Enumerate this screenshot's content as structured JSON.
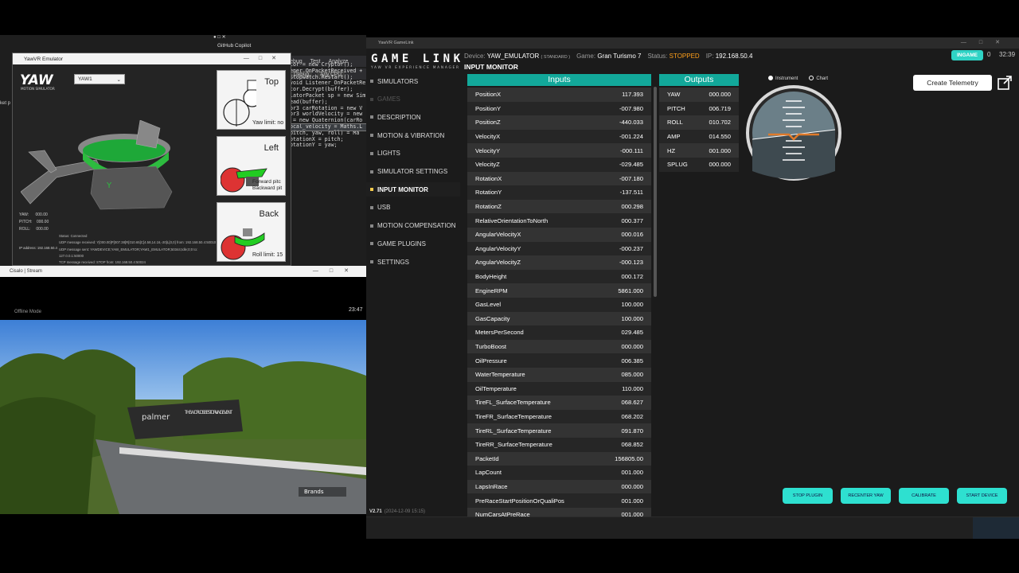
{
  "behind": {
    "github_copilot": "GitHub Copilot",
    "menu": [
      "Debug",
      "Test",
      "Analyze"
    ],
    "config": "Debug",
    "platform": "Any CPU",
    "code": [
      "ptor = new Cryptor();",
      "tener.OnPacketReceived +",
      "pStopwatch.Restart();",
      "",
      "",
      " void Listener_OnPacketRe",
      "",
      "ptor.Decrypt(buffer);",
      "ulatorPacket sp = new Sim",
      "Read(buffer);",
      "",
      "",
      "tor3 carRotation = new V",
      "tor3 worldVelocity = new",
      "",
      "",
      "Q = new Quaternion(carRo",
      "local_velocity = Maths.L",
      "",
      "(pitch, yaw, roll) = Ma",
      "",
      "",
      "RotationX = pitch;",
      "RotationY = yaw;"
    ],
    "left_text": "ket p"
  },
  "emulator": {
    "title": "YawVR Emulator",
    "device_select": "YAW1",
    "logo_sub": "MOTION SIMULATOR",
    "views": [
      {
        "label": "Top",
        "sub": "Yaw limit: no"
      },
      {
        "label": "Left",
        "sub": "Forward pitc\nBackward pit"
      },
      {
        "label": "Back",
        "sub": "Roll limit: 15"
      }
    ],
    "stats": [
      "YAW:      000.00",
      "PITCH:    000.00",
      "ROLL:     000.00"
    ],
    "ip_label": "IP address:  192.168.50.4",
    "log": [
      "Status:  Connected",
      "UDP message received: Y[000.00]P[007.38]R[010.65]C[4.58,14.16,-20]L[0,0] from: 192.168.50.4:50010",
      "UDP message sent: YAWDEVICE;YAW_EMULATOR;YAW1_EMULATOR;50344;Idle;0;0 to: 127.0.0.1:50000",
      "TCP message received: STOP from: 192.168.50.4:50024",
      "TCP message sent: ERROR;INVALID_COMMAND to: 192.168.50.4:50024"
    ]
  },
  "stream": {
    "title": "Cisalo | Stream",
    "offline": "Offline Mode",
    "clock": "23:47",
    "billboard_brand": "palmer",
    "billboard_text": "THE WORLD'S BEST DRIVING EVENT",
    "track_label": "Brands"
  },
  "gamelink": {
    "window_title": "YawVR GameLink",
    "logo": "GAME LINK",
    "logo_sub": "YAW VR EXPERIENCE MANAGER",
    "device_label": "Device:",
    "device": "YAW_EMULATOR",
    "device_type": "( STANDARD )",
    "game_label": "Game:",
    "game": "Gran Turismo 7",
    "status_label": "Status:",
    "status": "STOPPED",
    "ip_label": "IP:",
    "ip": "192.168.50.4",
    "badge": "INGAME",
    "badge_count": "0",
    "time": "32:39",
    "page_title": "INPUT MONITOR",
    "nav": [
      {
        "label": "SIMULATORS",
        "state": "normal"
      },
      {
        "label": "GAMES",
        "state": "dim"
      },
      {
        "label": "DESCRIPTION",
        "state": "normal"
      },
      {
        "label": "MOTION & VIBRATION",
        "state": "normal"
      },
      {
        "label": "LIGHTS",
        "state": "normal"
      },
      {
        "label": "SIMULATOR SETTINGS",
        "state": "normal"
      },
      {
        "label": "INPUT MONITOR",
        "state": "active"
      },
      {
        "label": "USB",
        "state": "normal"
      },
      {
        "label": "MOTION COMPENSATION",
        "state": "normal"
      },
      {
        "label": "GAME PLUGINS",
        "state": "normal"
      },
      {
        "label": "SETTINGS",
        "state": "normal"
      }
    ],
    "version": "V2.71",
    "version_date": "(2024-12-09 15:15)",
    "inputs_header": "Inputs",
    "outputs_header": "Outputs",
    "inputs": [
      [
        "PositionX",
        "117.393"
      ],
      [
        "PositionY",
        "-007.980"
      ],
      [
        "PositionZ",
        "-440.033"
      ],
      [
        "VelocityX",
        "-001.224"
      ],
      [
        "VelocityY",
        "-000.111"
      ],
      [
        "VelocityZ",
        "-029.485"
      ],
      [
        "RotationX",
        "-007.180"
      ],
      [
        "RotationY",
        "-137.511"
      ],
      [
        "RotationZ",
        "000.298"
      ],
      [
        "RelativeOrientationToNorth",
        "000.377"
      ],
      [
        "AngularVelocityX",
        "000.016"
      ],
      [
        "AngularVelocityY",
        "-000.237"
      ],
      [
        "AngularVelocityZ",
        "-000.123"
      ],
      [
        "BodyHeight",
        "000.172"
      ],
      [
        "EngineRPM",
        "5861.000"
      ],
      [
        "GasLevel",
        "100.000"
      ],
      [
        "GasCapacity",
        "100.000"
      ],
      [
        "MetersPerSecond",
        "029.485"
      ],
      [
        "TurboBoost",
        "000.000"
      ],
      [
        "OilPressure",
        "006.385"
      ],
      [
        "WaterTemperature",
        "085.000"
      ],
      [
        "OilTemperature",
        "110.000"
      ],
      [
        "TireFL_SurfaceTemperature",
        "068.627"
      ],
      [
        "TireFR_SurfaceTemperature",
        "068.202"
      ],
      [
        "TireRL_SurfaceTemperature",
        "091.870"
      ],
      [
        "TireRR_SurfaceTemperature",
        "068.852"
      ],
      [
        "PacketId",
        "156805.00"
      ],
      [
        "LapCount",
        "001.000"
      ],
      [
        "LapsInRace",
        "000.000"
      ],
      [
        "PreRaceStartPositionOrQualiPos",
        "001.000"
      ],
      [
        "NumCarsAtPreRace",
        "001.000"
      ]
    ],
    "outputs": [
      [
        "YAW",
        "000.000"
      ],
      [
        "PITCH",
        "006.719"
      ],
      [
        "ROLL",
        "010.702"
      ],
      [
        "AMP",
        "014.550"
      ],
      [
        "HZ",
        "001.000"
      ],
      [
        "SPLUG",
        "000.000"
      ]
    ],
    "radio_instrument": "Instrument",
    "radio_chart": "Chart",
    "create_telemetry": "Create Telemetry",
    "buttons": [
      "STOP PLUGIN",
      "RECENTER YAW",
      "CALIBRATE",
      "START DEVICE"
    ]
  },
  "colors": {
    "accent": "#2ee0d0",
    "header_teal": "#12a89a",
    "status_stopped": "#ff9f1a"
  },
  "icons": {
    "pop_out": "external-window-icon",
    "horizon": "attitude-indicator-icon"
  }
}
